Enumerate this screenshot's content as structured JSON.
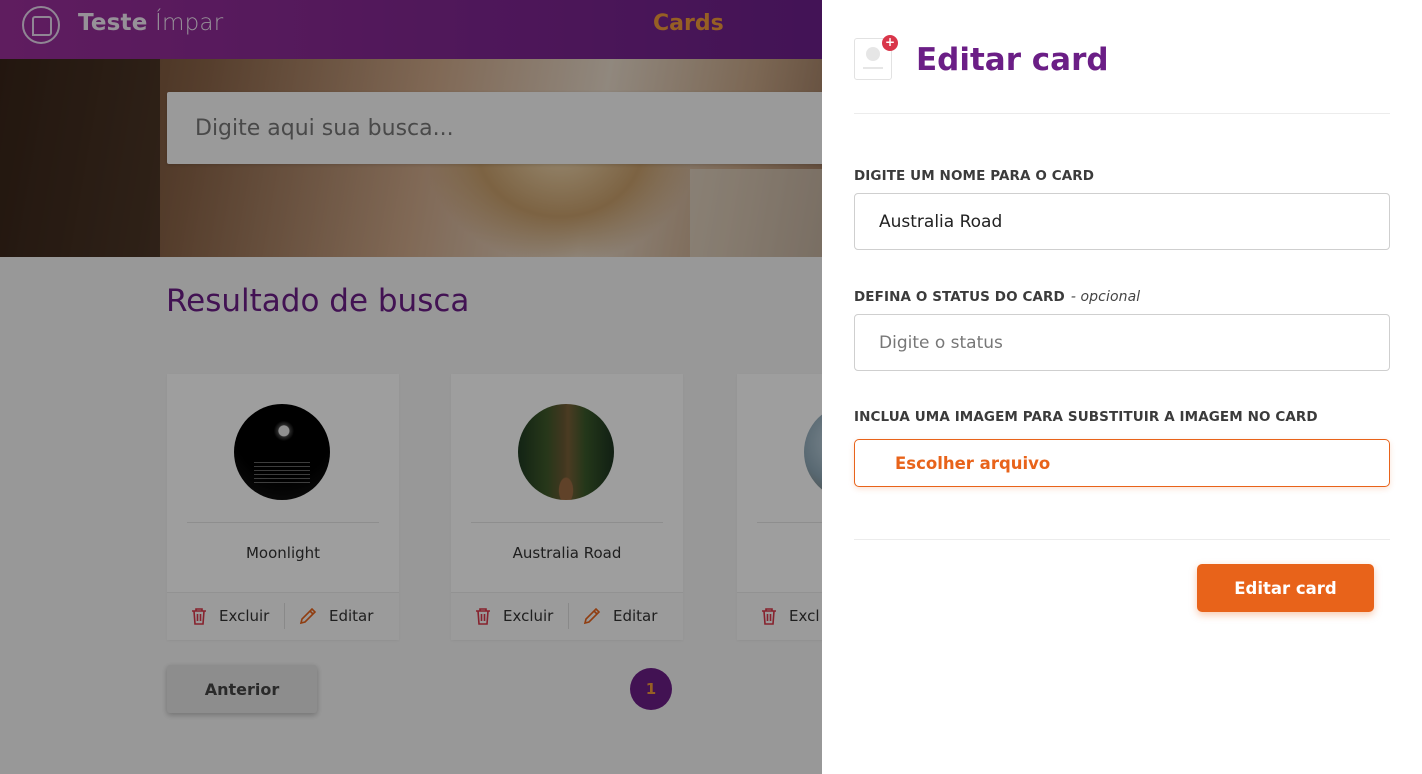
{
  "header": {
    "brand_bold": "Teste",
    "brand_light": "Ímpar",
    "nav_label": "Cards"
  },
  "search": {
    "placeholder": "Digite aqui sua busca..."
  },
  "results": {
    "title": "Resultado de busca",
    "cards": [
      {
        "name": "Moonlight",
        "delete_label": "Excluir",
        "edit_label": "Editar"
      },
      {
        "name": "Australia Road",
        "delete_label": "Excluir",
        "edit_label": "Editar"
      },
      {
        "name": "",
        "delete_label": "Excl",
        "edit_label": ""
      }
    ]
  },
  "pagination": {
    "prev_label": "Anterior",
    "current_page": "1"
  },
  "drawer": {
    "title": "Editar card",
    "name_field": {
      "label": "DIGITE UM NOME PARA O CARD",
      "value": "Australia Road"
    },
    "status_field": {
      "label": "DEFINA O STATUS DO CARD",
      "optional_note": "- opcional",
      "placeholder": "Digite o status"
    },
    "image_field": {
      "label": "INCLUA UMA IMAGEM PARA SUBSTITUIR A IMAGEM NO CARD",
      "button_label": "Escolher arquivo"
    },
    "submit_label": "Editar card",
    "badge": "+"
  },
  "colors": {
    "brand_purple": "#6b1e86",
    "accent_orange": "#e8631a",
    "badge_red": "#d9364a"
  },
  "icons": [
    "logo-icon",
    "trash-icon",
    "pencil-icon",
    "card-placeholder-icon"
  ]
}
